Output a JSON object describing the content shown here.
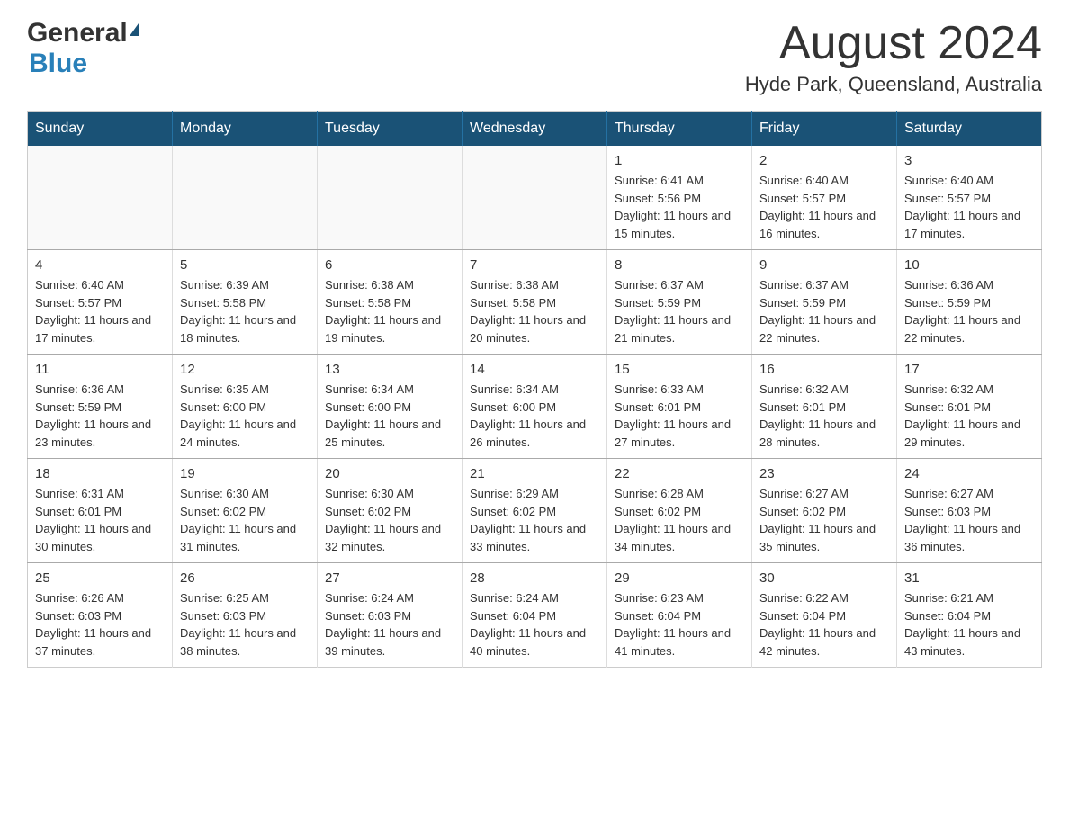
{
  "header": {
    "logo": {
      "general": "General",
      "arrow": "▶",
      "blue": "Blue"
    },
    "title": "August 2024",
    "location": "Hyde Park, Queensland, Australia"
  },
  "calendar": {
    "days_of_week": [
      "Sunday",
      "Monday",
      "Tuesday",
      "Wednesday",
      "Thursday",
      "Friday",
      "Saturday"
    ],
    "weeks": [
      {
        "days": [
          {
            "number": "",
            "info": ""
          },
          {
            "number": "",
            "info": ""
          },
          {
            "number": "",
            "info": ""
          },
          {
            "number": "",
            "info": ""
          },
          {
            "number": "1",
            "info": "Sunrise: 6:41 AM\nSunset: 5:56 PM\nDaylight: 11 hours and 15 minutes."
          },
          {
            "number": "2",
            "info": "Sunrise: 6:40 AM\nSunset: 5:57 PM\nDaylight: 11 hours and 16 minutes."
          },
          {
            "number": "3",
            "info": "Sunrise: 6:40 AM\nSunset: 5:57 PM\nDaylight: 11 hours and 17 minutes."
          }
        ]
      },
      {
        "days": [
          {
            "number": "4",
            "info": "Sunrise: 6:40 AM\nSunset: 5:57 PM\nDaylight: 11 hours and 17 minutes."
          },
          {
            "number": "5",
            "info": "Sunrise: 6:39 AM\nSunset: 5:58 PM\nDaylight: 11 hours and 18 minutes."
          },
          {
            "number": "6",
            "info": "Sunrise: 6:38 AM\nSunset: 5:58 PM\nDaylight: 11 hours and 19 minutes."
          },
          {
            "number": "7",
            "info": "Sunrise: 6:38 AM\nSunset: 5:58 PM\nDaylight: 11 hours and 20 minutes."
          },
          {
            "number": "8",
            "info": "Sunrise: 6:37 AM\nSunset: 5:59 PM\nDaylight: 11 hours and 21 minutes."
          },
          {
            "number": "9",
            "info": "Sunrise: 6:37 AM\nSunset: 5:59 PM\nDaylight: 11 hours and 22 minutes."
          },
          {
            "number": "10",
            "info": "Sunrise: 6:36 AM\nSunset: 5:59 PM\nDaylight: 11 hours and 22 minutes."
          }
        ]
      },
      {
        "days": [
          {
            "number": "11",
            "info": "Sunrise: 6:36 AM\nSunset: 5:59 PM\nDaylight: 11 hours and 23 minutes."
          },
          {
            "number": "12",
            "info": "Sunrise: 6:35 AM\nSunset: 6:00 PM\nDaylight: 11 hours and 24 minutes."
          },
          {
            "number": "13",
            "info": "Sunrise: 6:34 AM\nSunset: 6:00 PM\nDaylight: 11 hours and 25 minutes."
          },
          {
            "number": "14",
            "info": "Sunrise: 6:34 AM\nSunset: 6:00 PM\nDaylight: 11 hours and 26 minutes."
          },
          {
            "number": "15",
            "info": "Sunrise: 6:33 AM\nSunset: 6:01 PM\nDaylight: 11 hours and 27 minutes."
          },
          {
            "number": "16",
            "info": "Sunrise: 6:32 AM\nSunset: 6:01 PM\nDaylight: 11 hours and 28 minutes."
          },
          {
            "number": "17",
            "info": "Sunrise: 6:32 AM\nSunset: 6:01 PM\nDaylight: 11 hours and 29 minutes."
          }
        ]
      },
      {
        "days": [
          {
            "number": "18",
            "info": "Sunrise: 6:31 AM\nSunset: 6:01 PM\nDaylight: 11 hours and 30 minutes."
          },
          {
            "number": "19",
            "info": "Sunrise: 6:30 AM\nSunset: 6:02 PM\nDaylight: 11 hours and 31 minutes."
          },
          {
            "number": "20",
            "info": "Sunrise: 6:30 AM\nSunset: 6:02 PM\nDaylight: 11 hours and 32 minutes."
          },
          {
            "number": "21",
            "info": "Sunrise: 6:29 AM\nSunset: 6:02 PM\nDaylight: 11 hours and 33 minutes."
          },
          {
            "number": "22",
            "info": "Sunrise: 6:28 AM\nSunset: 6:02 PM\nDaylight: 11 hours and 34 minutes."
          },
          {
            "number": "23",
            "info": "Sunrise: 6:27 AM\nSunset: 6:02 PM\nDaylight: 11 hours and 35 minutes."
          },
          {
            "number": "24",
            "info": "Sunrise: 6:27 AM\nSunset: 6:03 PM\nDaylight: 11 hours and 36 minutes."
          }
        ]
      },
      {
        "days": [
          {
            "number": "25",
            "info": "Sunrise: 6:26 AM\nSunset: 6:03 PM\nDaylight: 11 hours and 37 minutes."
          },
          {
            "number": "26",
            "info": "Sunrise: 6:25 AM\nSunset: 6:03 PM\nDaylight: 11 hours and 38 minutes."
          },
          {
            "number": "27",
            "info": "Sunrise: 6:24 AM\nSunset: 6:03 PM\nDaylight: 11 hours and 39 minutes."
          },
          {
            "number": "28",
            "info": "Sunrise: 6:24 AM\nSunset: 6:04 PM\nDaylight: 11 hours and 40 minutes."
          },
          {
            "number": "29",
            "info": "Sunrise: 6:23 AM\nSunset: 6:04 PM\nDaylight: 11 hours and 41 minutes."
          },
          {
            "number": "30",
            "info": "Sunrise: 6:22 AM\nSunset: 6:04 PM\nDaylight: 11 hours and 42 minutes."
          },
          {
            "number": "31",
            "info": "Sunrise: 6:21 AM\nSunset: 6:04 PM\nDaylight: 11 hours and 43 minutes."
          }
        ]
      }
    ]
  }
}
